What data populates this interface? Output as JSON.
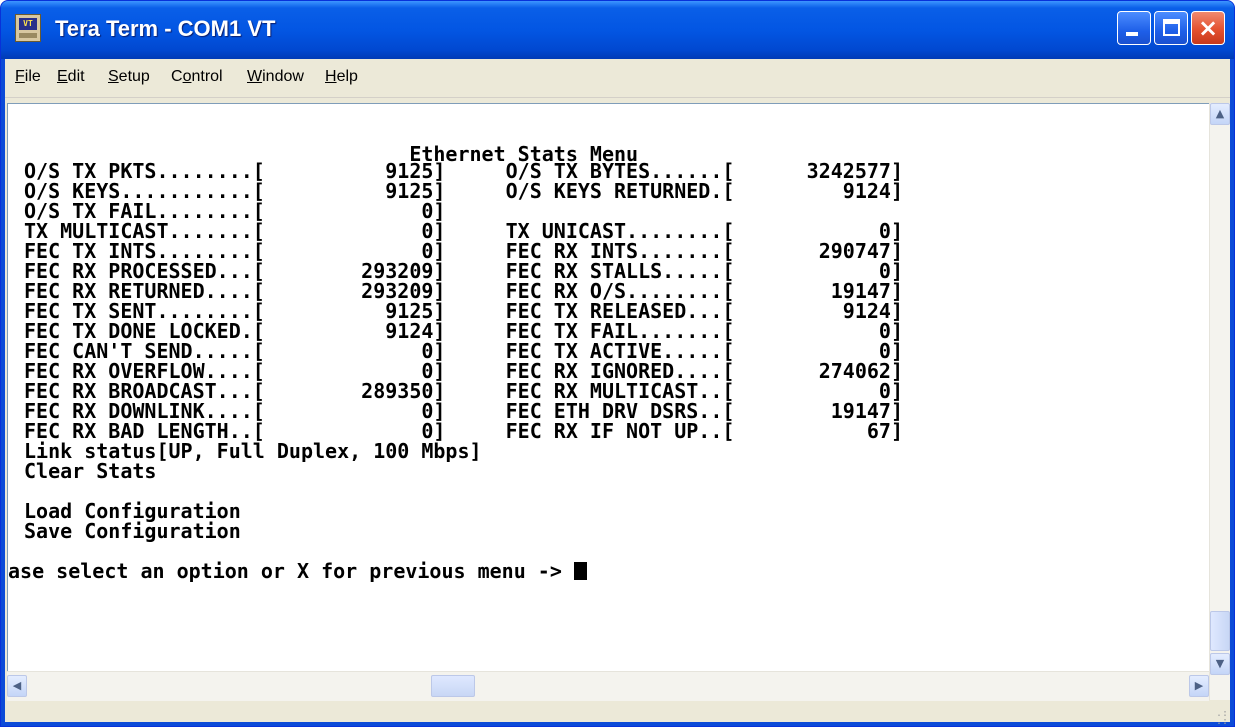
{
  "window": {
    "title": "Tera Term - COM1 VT",
    "icon_text": "VT",
    "controls": {
      "minimize": "minimize-icon",
      "maximize": "maximize-icon",
      "close": "×"
    }
  },
  "menu": [
    {
      "label": "File",
      "accel": "F",
      "rest": "ile"
    },
    {
      "label": "Edit",
      "accel": "E",
      "rest": "dit"
    },
    {
      "label": "Setup",
      "accel": "S",
      "rest": "etup"
    },
    {
      "label": "Control",
      "accel": "C",
      "rest": "o",
      "rest2": "ntrol"
    },
    {
      "label": "Window",
      "accel": "W",
      "rest": "indow"
    },
    {
      "label": "Help",
      "accel": "H",
      "rest": "elp"
    }
  ],
  "terminal": {
    "lines": [
      "                                Ethernet Stats Menu",
      "O/S TX PKTS........[          9125]     O/S TX BYTES......[      3242577]",
      "O/S KEYS...........[          9125]     O/S KEYS RETURNED.[         9124]",
      "O/S TX FAIL........[             0]",
      "TX MULTICAST.......[             0]     TX UNICAST........[            0]",
      "FEC TX INTS........[             0]     FEC RX INTS.......[       290747]",
      "FEC RX PROCESSED...[        293209]     FEC RX STALLS.....[            0]",
      "FEC RX RETURNED....[        293209]     FEC RX O/S........[        19147]",
      "FEC TX SENT........[          9125]     FEC TX RELEASED...[         9124]",
      "FEC TX DONE LOCKED.[          9124]     FEC TX FAIL.......[            0]",
      "FEC CAN'T SEND.....[             0]     FEC TX ACTIVE.....[            0]",
      "FEC RX OVERFLOW....[             0]     FEC RX IGNORED....[       274062]",
      "FEC RX BROADCAST...[        289350]     FEC RX MULTICAST..[            0]",
      "FEC RX DOWNLINK....[             0]     FEC ETH DRV DSRS..[        19147]",
      "FEC RX BAD LENGTH..[             0]     FEC RX IF NOT UP..[           67]",
      "Link status[UP, Full Duplex, 100 Mbps]",
      "Clear Stats",
      "",
      "Load Configuration",
      "Save Configuration",
      ""
    ],
    "prompt": "ase select an option or X for previous menu -> "
  },
  "colors": {
    "title_bar": "#0356e3",
    "close_button": "#e4512f",
    "terminal_bg": "#ffffff",
    "terminal_fg": "#000000"
  }
}
